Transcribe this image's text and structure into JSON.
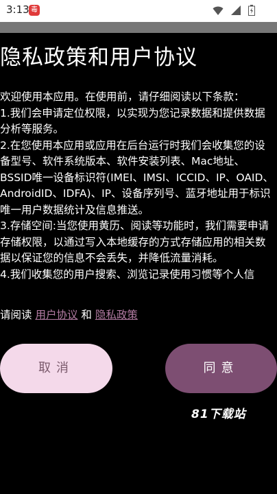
{
  "status_bar": {
    "time": "3:13",
    "app_icon_glyph": "毒",
    "icons": [
      "wifi-icon",
      "signal-icon",
      "battery-icon"
    ]
  },
  "dialog": {
    "title": "隐私政策和用户协议",
    "paragraphs": [
      "欢迎使用本应用。在使用前，请仔细阅读以下条款：",
      "",
      "1.我们会申请定位权限，以实现为您记录数据和提供数据分析等服务。",
      "2.在您使用本应用或应用在后台运行时我们会收集您的设备型号、软件系统版本、软件安装列表、Mac地址、BSSID唯一设备标识符(IMEI、IMSI、ICCID、IP、OAID、AndroidID、IDFA)、IP、设备序列号、蓝牙地址用于标识唯一用户数据统计及信息推送。",
      "3.存储空间:当您使用黄历、阅读等功能时，我们需要申请存储权限，以通过写入本地缓存的方式存储应用的相关数据以保证您的信息不会丢失，并降低流量消耗。",
      "4.我们收集您的用户搜索、浏览记录使用习惯等个人信"
    ],
    "agree_prefix": "请阅读 ",
    "user_agreement_link": "用户协议",
    "and_text": " 和 ",
    "privacy_policy_link": "隐私政策",
    "cancel_label": "取消",
    "agree_label": "同意"
  },
  "watermark": "81下载站",
  "colors": {
    "dialog_bg": "#000000",
    "link": "#b27ba2",
    "cancel_bg": "#f4d9ea",
    "agree_bg": "#7d4e72"
  }
}
